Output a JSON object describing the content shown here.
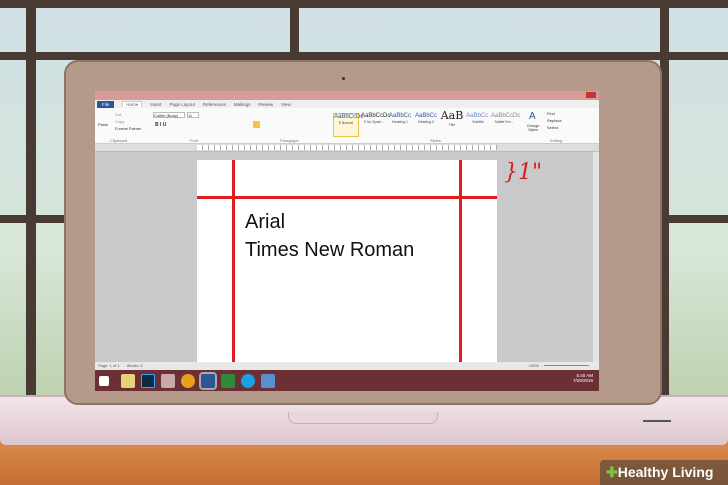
{
  "word": {
    "tabs": [
      "File",
      "Home",
      "Insert",
      "Page Layout",
      "References",
      "Mailings",
      "Review",
      "View"
    ],
    "clipboard": {
      "paste": "Paste",
      "cut": "Cut",
      "copy": "Copy",
      "format_painter": "Format Painter",
      "label": "Clipboard"
    },
    "font": {
      "name": "Calibri (Body)",
      "size": "11",
      "label": "Font"
    },
    "paragraph_label": "Paragraph",
    "styles": [
      {
        "preview": "AaBbCcDc",
        "name": "¶ Normal"
      },
      {
        "preview": "AaBbCcDc",
        "name": "¶ No Spaci..."
      },
      {
        "preview": "AaBbCc",
        "name": "Heading 1"
      },
      {
        "preview": "AaBbCc",
        "name": "Heading 2"
      },
      {
        "preview": "AaB",
        "name": "Title"
      },
      {
        "preview": "AaBbCc.",
        "name": "Subtitle"
      },
      {
        "preview": "AaBbCcDc",
        "name": "Subtle Em..."
      }
    ],
    "styles_label": "Styles",
    "change_styles": "Change Styles",
    "editing": {
      "find": "Find",
      "replace": "Replace",
      "select": "Select",
      "label": "Editing"
    },
    "document_lines": [
      "Arial",
      "Times New Roman"
    ],
    "status": {
      "page": "Page: 1 of 1",
      "words": "Words: 0",
      "zoom": "100%"
    },
    "clock": {
      "time": "5:40 AM",
      "date": "7/29/2016"
    }
  },
  "annotation": "}1\"",
  "logo": "Healthy Living",
  "colors": {
    "margin_lines": "#e21d1d",
    "taskbar": "#6b2f35",
    "title_bar": "#d99a9a"
  }
}
